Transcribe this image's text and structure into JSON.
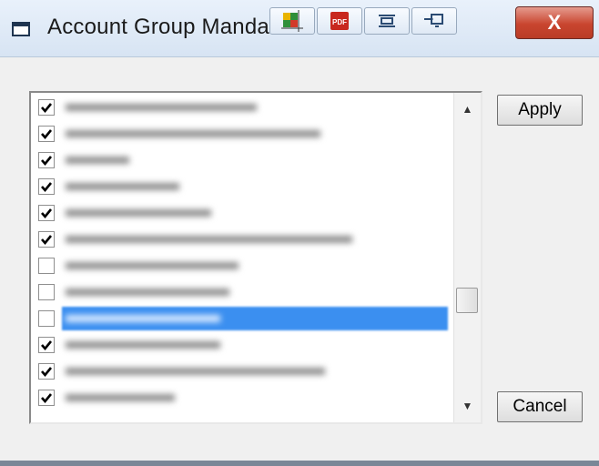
{
  "window": {
    "title": "Account Group Manda",
    "close_label": "X"
  },
  "buttons": {
    "apply_label": "Apply",
    "cancel_label": "Cancel"
  },
  "toolbar_icons": [
    "capture-icon",
    "pdf-icon",
    "align-icon",
    "screen-icon"
  ],
  "toolbar_pdf_text": "PDF",
  "list": {
    "items": [
      {
        "checked": true
      },
      {
        "checked": true
      },
      {
        "checked": true
      },
      {
        "checked": true
      },
      {
        "checked": true
      },
      {
        "checked": true
      },
      {
        "checked": false
      },
      {
        "checked": false
      },
      {
        "checked": false,
        "selected": true
      },
      {
        "checked": true
      },
      {
        "checked": true
      },
      {
        "checked": true
      }
    ]
  },
  "scroll": {
    "up_arrow": "▲",
    "down_arrow": "▼"
  },
  "colors": {
    "selection": "#3b8ff0",
    "close_button": "#c9452f"
  }
}
